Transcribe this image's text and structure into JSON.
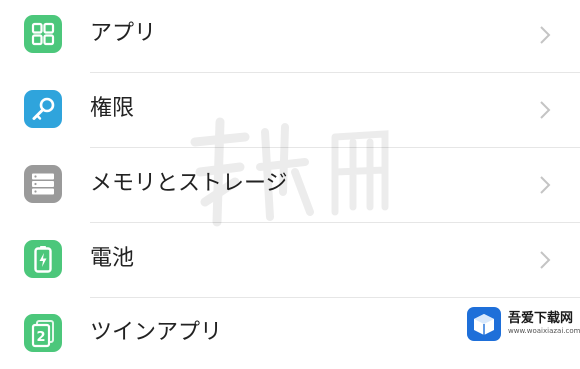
{
  "settings": {
    "items": [
      {
        "label": "アプリ",
        "icon": "apps-grid-icon",
        "color": "#4cc77b"
      },
      {
        "label": "権限",
        "icon": "key-icon",
        "color": "#2fa4dc"
      },
      {
        "label": "メモリとストレージ",
        "icon": "storage-icon",
        "color": "#9a9a9a"
      },
      {
        "label": "電池",
        "icon": "battery-icon",
        "color": "#4cc77b"
      },
      {
        "label": "ツインアプリ",
        "icon": "twin-apps-icon",
        "color": "#4cc77b"
      }
    ]
  },
  "watermark": {
    "text": "软件简"
  },
  "badge": {
    "site_name": "吾爱下载网",
    "site_url": "www.woaixiazai.com"
  },
  "colors": {
    "text": "#222222",
    "chevron": "#c4c4c4",
    "divider": "#e6e6e6",
    "badge_blue": "#1e6fd9"
  }
}
